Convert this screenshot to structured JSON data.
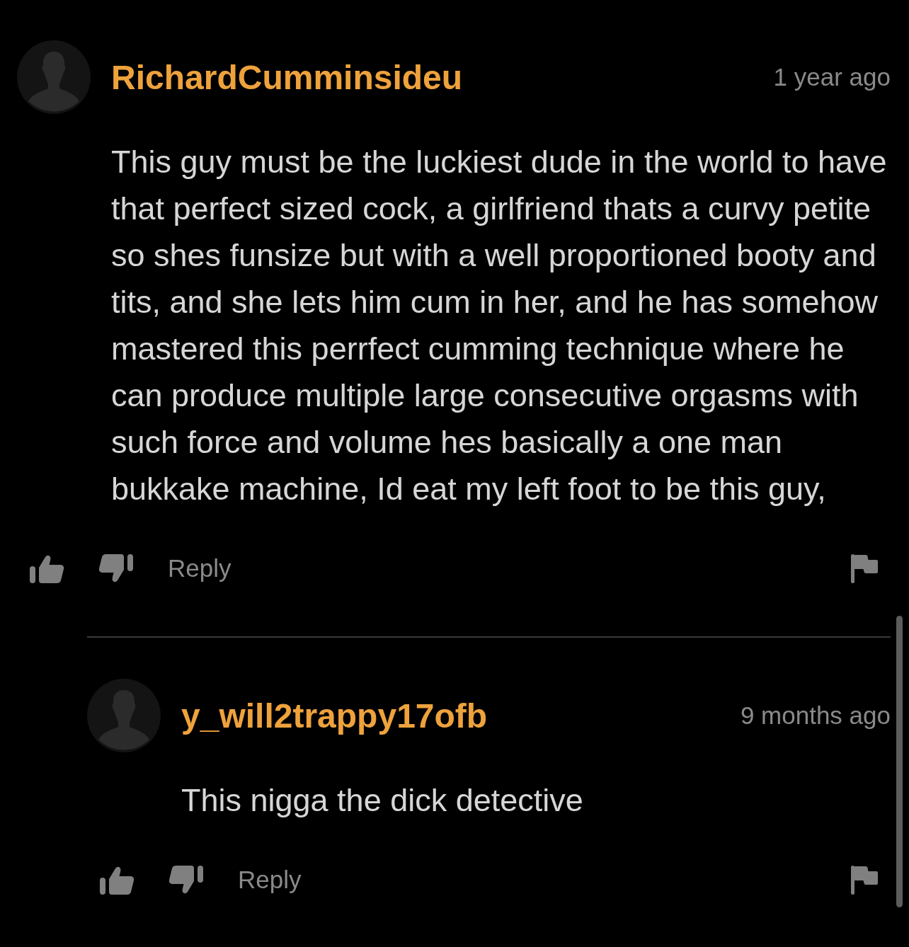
{
  "comments": [
    {
      "username": "RichardCumminsideu",
      "time": "1 year ago",
      "body": "This guy must be the luckiest dude in the world to have that perfect sized cock, a girlfriend thats a curvy petite so shes funsize but with a well proportioned booty and tits, and she lets him cum in her, and he has somehow mastered this perrfect cumming technique where he can produce multiple large consecutive orgasms with such force and volume hes basically a one man bukkake machine, Id eat my left foot to be this guy,",
      "reply_label": "Reply",
      "replies": [
        {
          "username": "y_will2trappy17ofb",
          "time": "9 months ago",
          "body": "This nigga the dick detective",
          "reply_label": "Reply"
        }
      ]
    }
  ]
}
